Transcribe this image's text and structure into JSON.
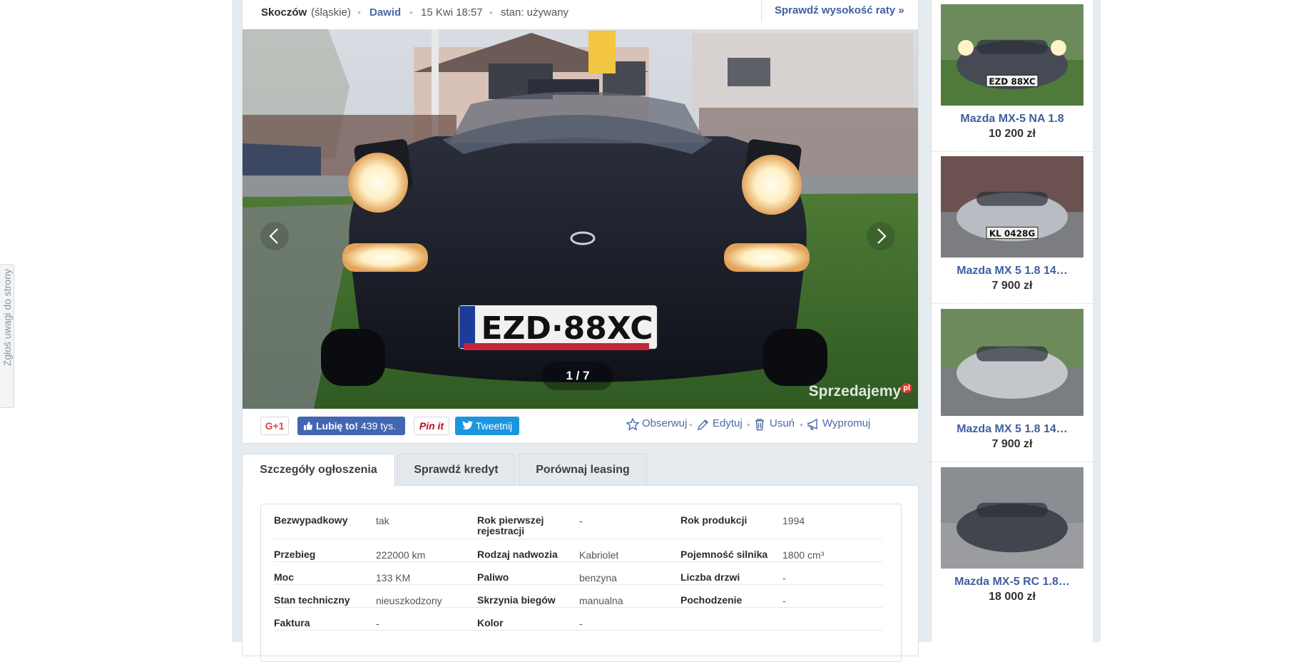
{
  "report_tab": {
    "label": "Zgłoś uwagi do strony"
  },
  "meta": {
    "city": "Skoczów",
    "region": "(śląskie)",
    "seller": "Dawid",
    "date": "15 Kwi 18:57",
    "condition": "stan: używany",
    "installment_link": "Sprawdź wysokość raty »"
  },
  "gallery": {
    "counter": "1 / 7",
    "plate": "EZD·88XC",
    "watermark": "Sprzedajemy",
    "watermark_tld": "pl"
  },
  "social": {
    "gplus": "G+1",
    "fb_like": "Lubię to!",
    "fb_count": "439 tys.",
    "pinit": "Pin it",
    "tweet": "Tweetnij"
  },
  "actions": {
    "watch": "Obserwuj",
    "edit": "Edytuj",
    "delete": "Usuń",
    "promote": "Wypromuj"
  },
  "tabs": [
    "Szczegóły ogłoszenia",
    "Sprawdź kredyt",
    "Porównaj leasing"
  ],
  "params": [
    [
      {
        "label": "Bezwypadkowy",
        "value": "tak"
      },
      {
        "label": "Rok pierwszej rejestracji",
        "value": "-"
      },
      {
        "label": "Rok produkcji",
        "value": "1994"
      }
    ],
    [
      {
        "label": "Przebieg",
        "value": "222000 km"
      },
      {
        "label": "Rodzaj nadwozia",
        "value": "Kabriolet"
      },
      {
        "label": "Pojemność silnika",
        "value": "1800 cm³"
      }
    ],
    [
      {
        "label": "Moc",
        "value": "133 KM"
      },
      {
        "label": "Paliwo",
        "value": "benzyna"
      },
      {
        "label": "Liczba drzwi",
        "value": "-"
      }
    ],
    [
      {
        "label": "Stan techniczny",
        "value": "nieuszkodzony"
      },
      {
        "label": "Skrzynia biegów",
        "value": "manualna"
      },
      {
        "label": "Pochodzenie",
        "value": "-"
      }
    ],
    [
      {
        "label": "Faktura",
        "value": "-"
      },
      {
        "label": "Kolor",
        "value": "-"
      },
      {
        "label": "",
        "value": ""
      }
    ]
  ],
  "similar": [
    {
      "name": "Mazda MX-5 NA 1.8",
      "price": "10 200 zł",
      "plate": "EZD 88XC"
    },
    {
      "name": "Mazda MX 5 1.8 14…",
      "price": "7 900 zł",
      "plate": "KL 0428G"
    },
    {
      "name": "Mazda MX 5 1.8 14…",
      "price": "7 900 zł",
      "plate": ""
    },
    {
      "name": "Mazda MX-5 RC 1.8…",
      "price": "18 000 zł",
      "plate": ""
    }
  ],
  "colors": {
    "link": "#4a6aa6",
    "background": "#e6ebef",
    "facebook": "#4267b2",
    "twitter": "#1b95e0",
    "pinterest": "#bd081c",
    "google": "#dd4b39"
  }
}
